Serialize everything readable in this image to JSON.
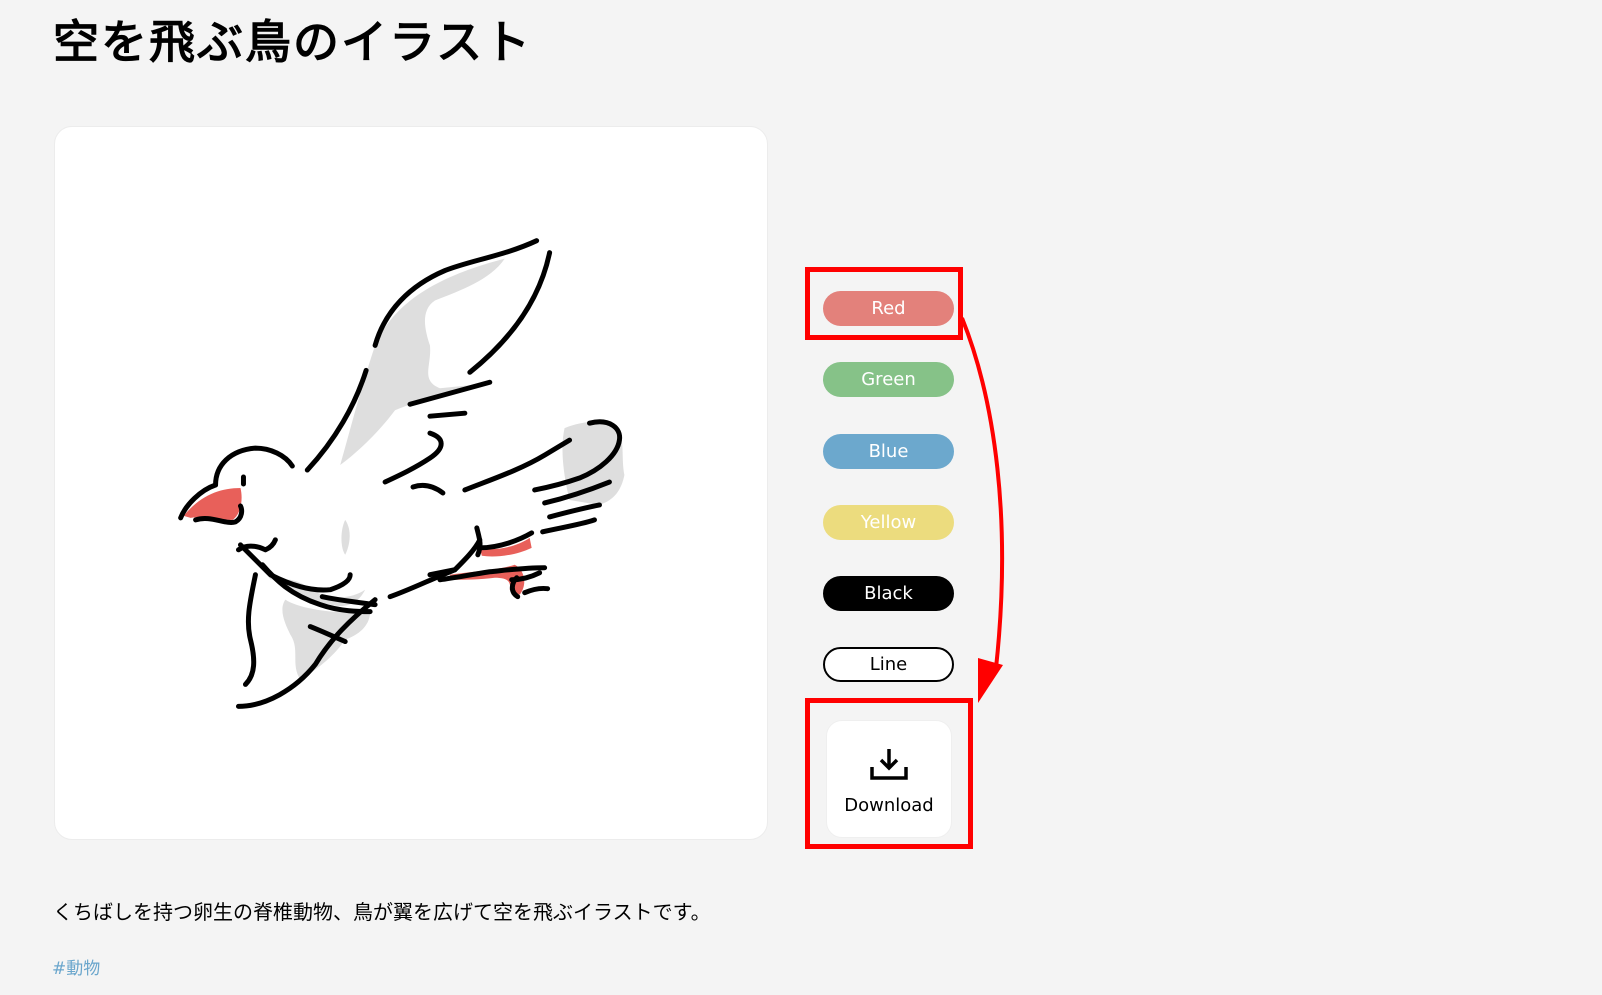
{
  "page": {
    "title": "空を飛ぶ鳥のイラスト",
    "description": "くちばしを持つ卵生の脊椎動物、鳥が翼を広げて空を飛ぶイラストです。",
    "tag": "#動物"
  },
  "illustration": {
    "subject": "flying bird",
    "accent_color": "#e8605a",
    "shade_color": "#dedede",
    "stroke_color": "#000000"
  },
  "color_options": [
    {
      "label": "Red",
      "color": "#e3817b",
      "text_color": "#ffffff"
    },
    {
      "label": "Green",
      "color": "#86c288",
      "text_color": "#ffffff"
    },
    {
      "label": "Blue",
      "color": "#6ca8cd",
      "text_color": "#ffffff"
    },
    {
      "label": "Yellow",
      "color": "#ecdc7e",
      "text_color": "#ffffff"
    },
    {
      "label": "Black",
      "color": "#000000",
      "text_color": "#ffffff"
    },
    {
      "label": "Line",
      "color": "#ffffff",
      "text_color": "#000000"
    }
  ],
  "download": {
    "label": "Download",
    "icon": "download-icon"
  },
  "annotation": {
    "color": "#ff0000",
    "from": "Red",
    "to": "Download"
  }
}
